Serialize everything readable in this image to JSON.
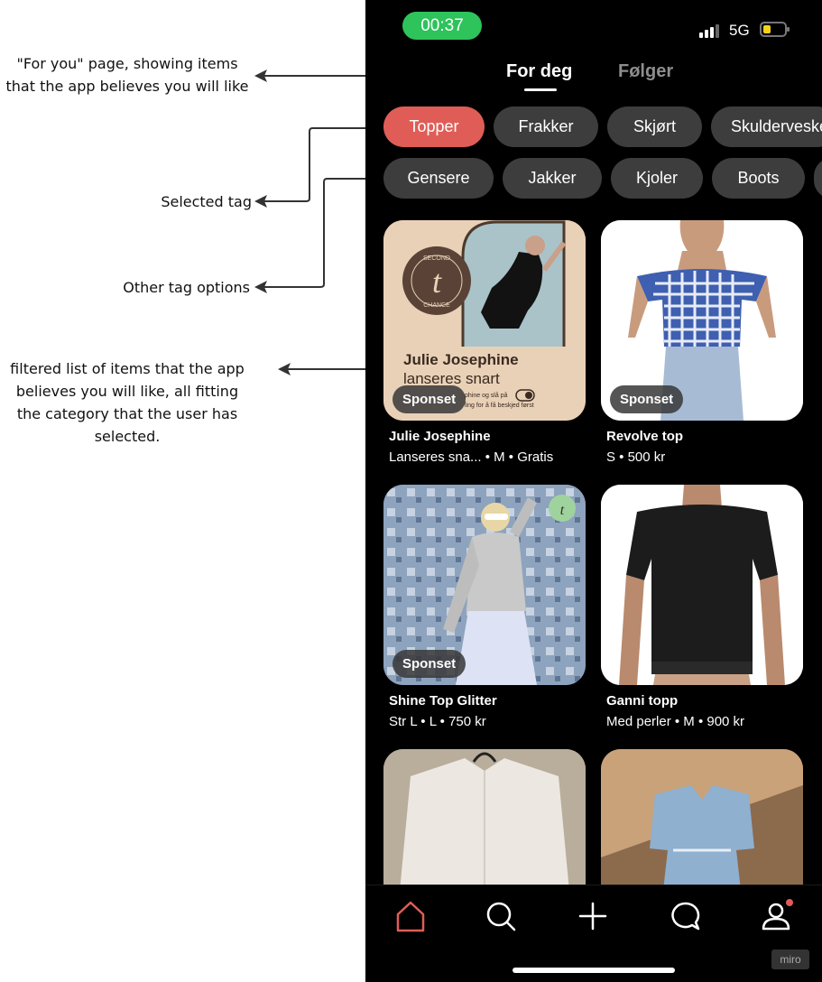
{
  "annotations": {
    "for_you_line1": "\"For you\" page, showing items",
    "for_you_line2": "that the app believes you will like",
    "selected_tag": "Selected tag",
    "other_tags": "Other tag options",
    "filtered_line1": "filtered list of items that the app",
    "filtered_line2": "believes you will like, all fitting",
    "filtered_line3": "the category that the user has",
    "filtered_line4": "selected."
  },
  "status": {
    "time": "00:37",
    "network": "5G",
    "battery_level": 0.35
  },
  "tabs": {
    "active": "For deg",
    "other": "Følger"
  },
  "chips_row1": [
    "Topper",
    "Frakker",
    "Skjørt",
    "Skulderveske"
  ],
  "chips_row2": [
    "Gensere",
    "Jakker",
    "Kjoler",
    "Boots"
  ],
  "cards": [
    {
      "badge": "Sponset",
      "title": "Julie Josephine",
      "subtitle": "Lanseres sna...  • M • Gratis",
      "ad_brand": "Julie Josephine",
      "ad_tagline": "lanseres snart",
      "ad_small1": "phine og slå på",
      "ad_small2": "ling for å få beskjed først"
    },
    {
      "badge": "Sponset",
      "title": "Revolve top",
      "subtitle": "S • 500 kr"
    },
    {
      "badge": "Sponset",
      "title": "Shine Top Glitter",
      "subtitle": "Str L • L • 750 kr"
    },
    {
      "title": "Ganni topp",
      "subtitle": "Med perler • M • 900 kr"
    }
  ],
  "logo_text": {
    "top": "SECOND",
    "letter": "t",
    "bottom": "CHANCE"
  },
  "nav": [
    "home-icon",
    "search-icon",
    "plus-icon",
    "chat-icon",
    "profile-icon"
  ],
  "watermark": "miro",
  "colors": {
    "accent": "#e05d57",
    "chip": "#3d3d3d",
    "status_green": "#2ec35b",
    "background": "#000000"
  }
}
